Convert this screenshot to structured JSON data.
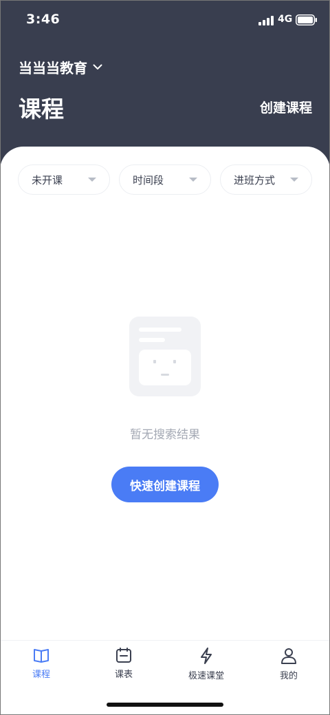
{
  "status_bar": {
    "time": "3:46",
    "network": "4G"
  },
  "header": {
    "org_name": "当当当教育",
    "title": "课程",
    "create_label": "创建课程"
  },
  "filters": [
    {
      "label": "未开课"
    },
    {
      "label": "时间段"
    },
    {
      "label": "进班方式"
    }
  ],
  "empty_state": {
    "message": "暂无搜索结果",
    "button_label": "快速创建课程"
  },
  "tab_bar": {
    "items": [
      {
        "label": "课程",
        "icon": "book-icon",
        "active": true
      },
      {
        "label": "课表",
        "icon": "calendar-icon",
        "active": false
      },
      {
        "label": "极速课堂",
        "icon": "lightning-icon",
        "active": false
      },
      {
        "label": "我的",
        "icon": "user-icon",
        "active": false
      }
    ]
  },
  "colors": {
    "header_bg": "#393e4f",
    "accent": "#4a7cf5",
    "muted_text": "#a4a9b4"
  }
}
